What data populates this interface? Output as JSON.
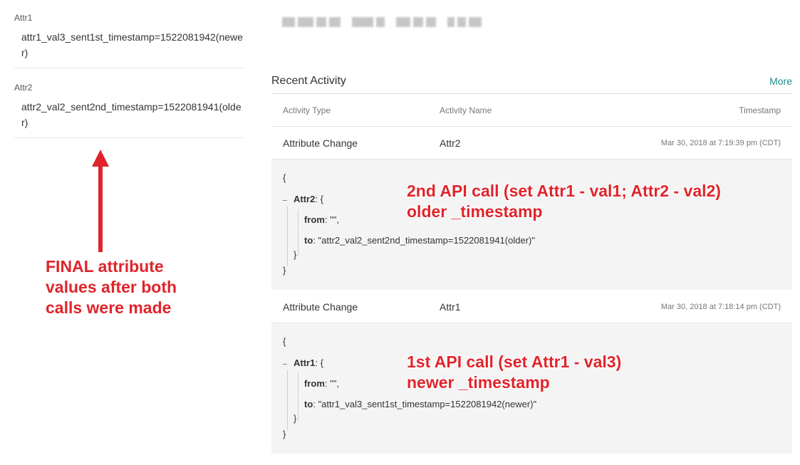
{
  "attributes": [
    {
      "name": "Attr1",
      "value": "attr1_val3_sent1st_timestamp=1522081942(newer)"
    },
    {
      "name": "Attr2",
      "value": "attr2_val2_sent2nd_timestamp=1522081941(older)"
    }
  ],
  "recent_activity": {
    "title": "Recent Activity",
    "more_label": "More",
    "columns": [
      "Activity Type",
      "Activity Name",
      "Timestamp"
    ],
    "rows": [
      {
        "type": "Attribute Change",
        "name": "Attr2",
        "timestamp": "Mar 30, 2018 at 7:19:39 pm (CDT)",
        "detail": {
          "open": "{",
          "key": "Attr2",
          "key_open": ": {",
          "from_label": "from",
          "from_value": ": \"\",",
          "to_label": "to",
          "to_value": ": \"attr2_val2_sent2nd_timestamp=1522081941(older)\"",
          "inner_close": "}",
          "close": "}"
        }
      },
      {
        "type": "Attribute Change",
        "name": "Attr1",
        "timestamp": "Mar 30, 2018 at 7:18:14 pm (CDT)",
        "detail": {
          "open": "{",
          "key": "Attr1",
          "key_open": ": {",
          "from_label": "from",
          "from_value": ": \"\",",
          "to_label": "to",
          "to_value": ": \"attr1_val3_sent1st_timestamp=1522081942(newer)\"",
          "inner_close": "}",
          "close": "}"
        }
      }
    ]
  },
  "annotations": {
    "final": "FINAL attribute\nvalues after both\ncalls were made",
    "call2": "2nd API call (set Attr1 - val1; Attr2 - val2)\nolder _timestamp",
    "call1": "1st API call (set Attr1 - val3)\nnewer _timestamp"
  },
  "colors": {
    "annotation": "#e0242b",
    "link": "#1a8f8a",
    "detail_bg": "#f4f4f4"
  }
}
